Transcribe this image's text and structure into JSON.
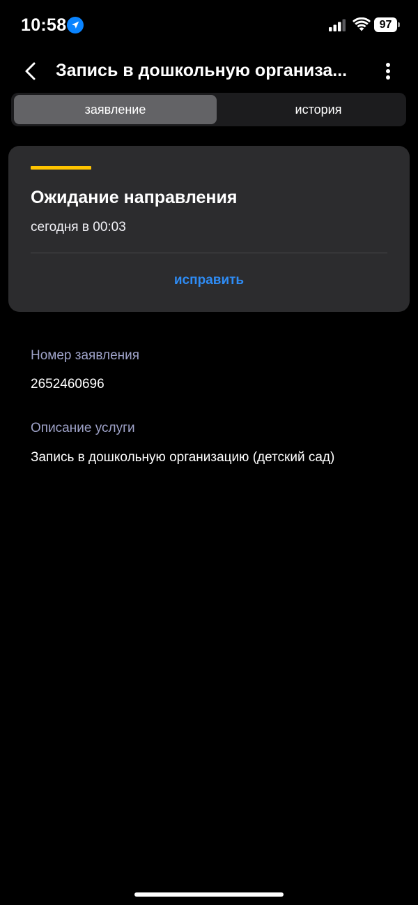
{
  "status_bar": {
    "time": "10:58",
    "battery": "97",
    "location_icon": "location-arrow-icon",
    "signal_icon": "cellular-signal-icon",
    "wifi_icon": "wifi-icon"
  },
  "header": {
    "title": "Запись в дошкольную организа...",
    "back_icon": "chevron-left-icon",
    "more_icon": "more-vertical-icon"
  },
  "tabs": [
    {
      "label": "заявление",
      "active": true
    },
    {
      "label": "история",
      "active": false
    }
  ],
  "status_card": {
    "status": "Ожидание направления",
    "time": "сегодня в 00:03",
    "action_label": "исправить",
    "accent_color": "#ffc400",
    "action_color": "#2e8cf5"
  },
  "details": [
    {
      "label": "Номер заявления",
      "value": "2652460696"
    },
    {
      "label": "Описание услуги",
      "value": "Запись в дошкольную организацию (детский сад)"
    }
  ]
}
